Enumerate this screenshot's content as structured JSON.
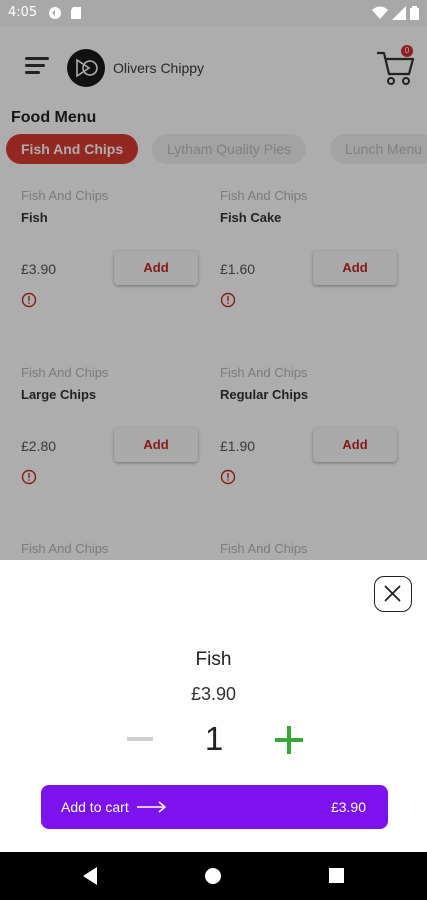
{
  "status_bar": {
    "time": "4:05"
  },
  "header": {
    "shop_name": "Olivers Chippy",
    "cart_count": "0"
  },
  "menu": {
    "title": "Food Menu",
    "tabs": [
      {
        "label": "Fish And Chips",
        "active": true
      },
      {
        "label": "Lytham Quality Pies",
        "active": false
      },
      {
        "label": "Lunch Menu",
        "active": false
      }
    ],
    "items": [
      {
        "category": "Fish And Chips",
        "name": "Fish",
        "price": "£3.90",
        "add_label": "Add"
      },
      {
        "category": "Fish And Chips",
        "name": "Fish Cake",
        "price": "£1.60",
        "add_label": "Add"
      },
      {
        "category": "Fish And Chips",
        "name": "Large Chips",
        "price": "£2.80",
        "add_label": "Add"
      },
      {
        "category": "Fish And Chips",
        "name": "Regular Chips",
        "price": "£1.90",
        "add_label": "Add"
      },
      {
        "category": "Fish And Chips",
        "name": ""
      },
      {
        "category": "Fish And Chips",
        "name": ""
      }
    ]
  },
  "sheet": {
    "item_name": "Fish",
    "item_price": "£3.90",
    "quantity": "1",
    "add_to_cart_label": "Add to cart",
    "total": "£3.90"
  },
  "colors": {
    "accent_red": "#d93a33",
    "button_purple": "#7c13ec",
    "plus_green": "#3aa63a"
  }
}
